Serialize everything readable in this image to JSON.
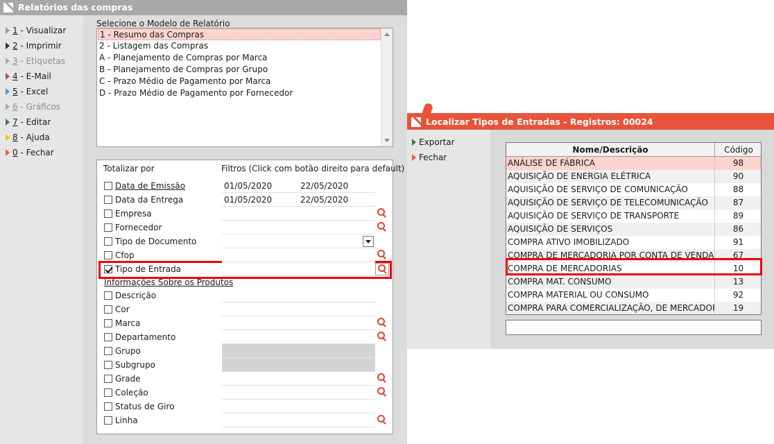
{
  "main_window": {
    "title": "Relatórios das compras",
    "menu": [
      {
        "key": "1",
        "label": " - Visualizar",
        "enabled": true,
        "color": "#999999"
      },
      {
        "key": "2",
        "label": " - Imprimir",
        "enabled": true,
        "color": "#333333"
      },
      {
        "key": "3",
        "label": " - Etiquetas",
        "enabled": false,
        "color": "#aaaaaa"
      },
      {
        "key": "4",
        "label": " - E-Mail",
        "enabled": true,
        "color": "#b05050"
      },
      {
        "key": "5",
        "label": " - Excel",
        "enabled": true,
        "color": "#3fa0d8"
      },
      {
        "key": "6",
        "label": " - Gráficos",
        "enabled": false,
        "color": "#aaaaaa"
      },
      {
        "key": "7",
        "label": " - Editar",
        "enabled": true,
        "color": "#3a7d3a"
      },
      {
        "key": "8",
        "label": " - Ajuda",
        "enabled": true,
        "color": "#e6c800"
      },
      {
        "key": "0",
        "label": " - Fechar",
        "enabled": true,
        "color": "#e8623a"
      }
    ],
    "model_label": "Selecione o Modelo de Relatório",
    "models": [
      "1 - Resumo das Compras",
      "2 - Listagem das Compras",
      "A - Planejamento de Compras por Marca",
      "B - Planejamento de Compras por Grupo",
      "C - Prazo Médio de Pagamento por Marca",
      "D - Prazo Médio de Pagamento por Fornecedor"
    ],
    "selected_model_index": 0,
    "totalizar_label": "Totalizar por",
    "filtros_label": "Filtros (Click com botão direito para default)",
    "section_produtos": "Informações Sobre os Produtos",
    "filters": [
      {
        "label": "Data de Emissão",
        "checked": false,
        "from": "01/05/2020",
        "to": "22/05/2020"
      },
      {
        "label": "Data da Entrega",
        "checked": false,
        "from": "01/05/2020",
        "to": "22/05/2020"
      },
      {
        "label": "Empresa",
        "checked": false
      },
      {
        "label": "Fornecedor",
        "checked": false
      },
      {
        "label": "Tipo de Documento",
        "checked": false
      },
      {
        "label": "Cfop",
        "checked": false
      },
      {
        "label": "Tipo de Entrada",
        "checked": true
      }
    ],
    "product_filters": [
      {
        "label": "Descrição",
        "checked": false
      },
      {
        "label": "Cor",
        "checked": false
      },
      {
        "label": "Marca",
        "checked": false
      },
      {
        "label": "Departamento",
        "checked": false
      },
      {
        "label": "Grupo",
        "checked": false
      },
      {
        "label": "Subgrupo",
        "checked": false
      },
      {
        "label": "Grade",
        "checked": false
      },
      {
        "label": "Coleção",
        "checked": false
      },
      {
        "label": "Status de Giro",
        "checked": false
      },
      {
        "label": "Linha",
        "checked": false
      }
    ]
  },
  "locator_window": {
    "title": "Localizar Tipos de Entradas - Registros: 00024",
    "menu": [
      {
        "label": "Exportar",
        "color": "#3a7d3a"
      },
      {
        "label": "Fechar",
        "color": "#e8623a"
      }
    ],
    "columns": [
      "Nome/Descrição",
      "Código"
    ],
    "rows": [
      {
        "name": "ANÁLISE DE FÁBRICA",
        "code": "98"
      },
      {
        "name": "AQUISIÇÃO DE ENERGIA ELÉTRICA",
        "code": "90"
      },
      {
        "name": "AQUISIÇÃO DE SERVIÇO DE COMUNICAÇÃO",
        "code": "88"
      },
      {
        "name": "AQUISIÇÃO DE SERVIÇO DE TELECOMUNICAÇÃO",
        "code": "87"
      },
      {
        "name": "AQUISIÇÃO DE SERVIÇO DE TRANSPORTE",
        "code": "89"
      },
      {
        "name": "AQUISIÇÃO DE SERVIÇOS",
        "code": "86"
      },
      {
        "name": "COMPRA ATIVO IMOBILIZADO",
        "code": "91"
      },
      {
        "name": "COMPRA DE MERCADORIA POR CONTA DE VENDA A ORDEM",
        "code": "67"
      },
      {
        "name": "COMPRA DE MERCADORIAS",
        "code": "10"
      },
      {
        "name": "COMPRA MAT. CONSUMO",
        "code": "13"
      },
      {
        "name": "COMPRA MATERIAL OU CONSUMO",
        "code": "92"
      },
      {
        "name": "COMPRA PARA COMERCIALIZAÇÃO, DE MERCADORIA RECEBIDA",
        "code": "19"
      }
    ],
    "selected_row_index": 0,
    "highlighted_row_index": 8,
    "search_value": ""
  }
}
